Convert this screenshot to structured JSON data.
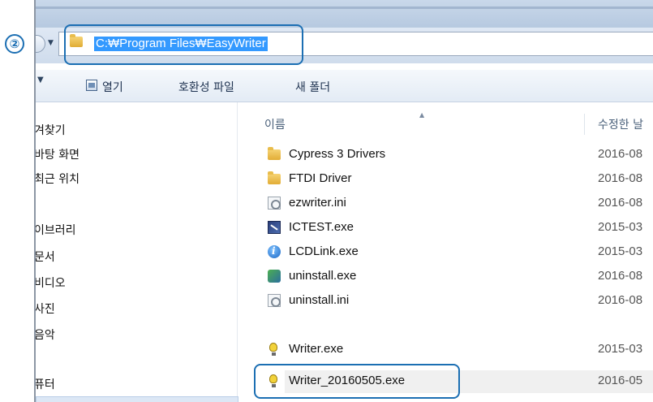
{
  "step_marker": "②",
  "address": {
    "path": "C:₩Program Files₩EasyWriter"
  },
  "toolbar": {
    "open_label": "열기",
    "compat_label": "호환성 파일",
    "new_folder_label": "새 폴더"
  },
  "sidebar": {
    "items": [
      {
        "label": "겨찾기"
      },
      {
        "label": "바탕 화면"
      },
      {
        "label": "최근 위치"
      },
      {
        "label": "이브러리"
      },
      {
        "label": "문서"
      },
      {
        "label": "비디오"
      },
      {
        "label": "사진"
      },
      {
        "label": "음악"
      },
      {
        "label": "퓨터"
      }
    ]
  },
  "columns": {
    "name": "이름",
    "modified": "수정한 날"
  },
  "files": [
    {
      "name": "Cypress 3 Drivers",
      "date": "2016-08",
      "icon": "folder-icon"
    },
    {
      "name": "FTDI Driver",
      "date": "2016-08",
      "icon": "folder-icon"
    },
    {
      "name": "ezwriter.ini",
      "date": "2016-08",
      "icon": "ini-file-icon"
    },
    {
      "name": "ICTEST.exe",
      "date": "2015-03",
      "icon": "ictest-app-icon"
    },
    {
      "name": "LCDLink.exe",
      "date": "2015-03",
      "icon": "lcdlink-app-icon"
    },
    {
      "name": "uninstall.exe",
      "date": "2016-08",
      "icon": "uninstall-app-icon"
    },
    {
      "name": "uninstall.ini",
      "date": "2016-08",
      "icon": "ini-file-icon"
    },
    {
      "name": "Writer.exe",
      "date": "2015-03",
      "icon": "lightbulb-app-icon"
    },
    {
      "name": "Writer_20160505.exe",
      "date": "2016-05",
      "icon": "lightbulb-app-icon"
    }
  ],
  "colors": {
    "annotation": "#1c6fb3",
    "address_selection": "#3399ff"
  }
}
